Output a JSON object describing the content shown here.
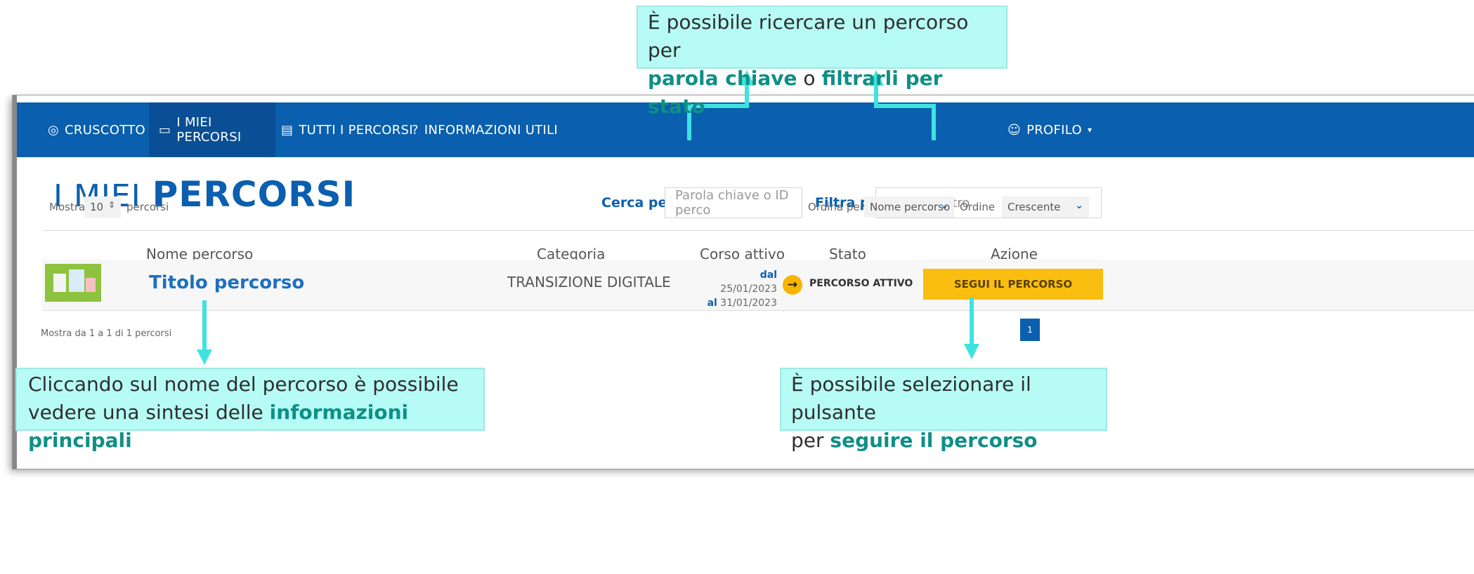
{
  "colors": {
    "navbar": "#0a5fae",
    "accent_button": "#f9be10",
    "callout_bg": "#b6fbf6",
    "connector": "#3ee3e0",
    "highlight_text": "#0f8f86"
  },
  "navbar": {
    "items": [
      {
        "icon": "target-icon",
        "label": "CRUSCOTTO"
      },
      {
        "icon": "monitor-icon",
        "label": "I MIEI PERCORSI",
        "active": true
      },
      {
        "icon": "list-icon",
        "label": "TUTTI I PERCORSI"
      },
      {
        "icon": "help-icon",
        "label": "INFORMAZIONI UTILI"
      }
    ],
    "profile": {
      "icon": "user-icon",
      "label": "PROFILO"
    }
  },
  "page_title": {
    "light": "I MIEI",
    "bold": "PERCORSI"
  },
  "search": {
    "label": "Cerca per:",
    "placeholder": "Parola chiave o ID perco"
  },
  "filter": {
    "label": "Filtra per:",
    "value": "Nessun filtro"
  },
  "show": {
    "prefix": "Mostra",
    "value": "10",
    "suffix": "percorsi"
  },
  "sort": {
    "order_by_label": "Ordina per",
    "order_by_value": "Nome percorso",
    "order_label": "Ordine",
    "order_value": "Crescente"
  },
  "table": {
    "headers": {
      "name": "Nome percorso",
      "category": "Categoria",
      "active_course": "Corso attivo",
      "status": "Stato",
      "action": "Azione"
    },
    "rows": [
      {
        "title": "Titolo percorso",
        "category": "TRANSIZIONE DIGITALE",
        "from_label": "dal",
        "from_date": "25/01/2023",
        "to_label": "al",
        "to_date": "31/01/2023",
        "status": "PERCORSO ATTIVO",
        "action": "SEGUI IL PERCORSO"
      }
    ]
  },
  "footer": {
    "summary": "Mostra da 1 a 1 di 1 percorsi",
    "page": "1"
  },
  "callouts": {
    "top": {
      "text1": "È possibile ricercare un percorso per",
      "hl1": "parola chiave",
      "mid": " o ",
      "hl2": "filtrarli per stato"
    },
    "bottom_left": {
      "text1": "Cliccando sul nome del percorso è possibile",
      "text2": "vedere una sintesi delle ",
      "hl": "informazioni principali"
    },
    "bottom_right": {
      "text1": "È possibile selezionare il pulsante",
      "text2": "per ",
      "hl": "seguire il percorso"
    }
  }
}
